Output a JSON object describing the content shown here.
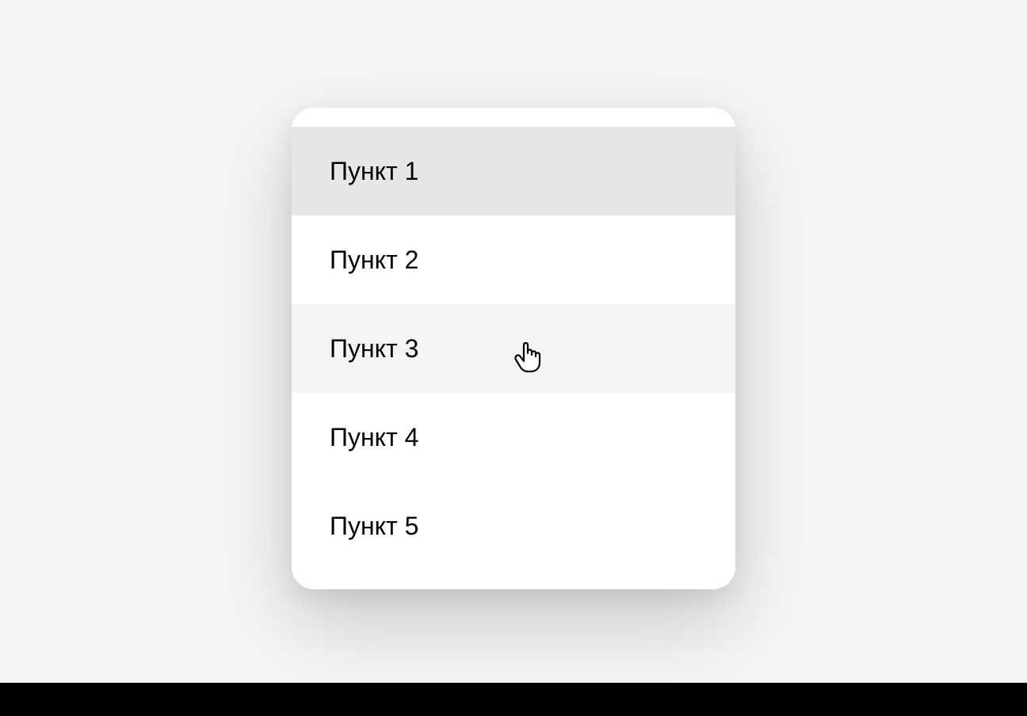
{
  "menu": {
    "items": [
      {
        "label": "Пункт 1",
        "state": "selected"
      },
      {
        "label": "Пункт 2",
        "state": "normal"
      },
      {
        "label": "Пункт 3",
        "state": "hovered"
      },
      {
        "label": "Пункт 4",
        "state": "normal"
      },
      {
        "label": "Пункт 5",
        "state": "normal"
      }
    ]
  }
}
